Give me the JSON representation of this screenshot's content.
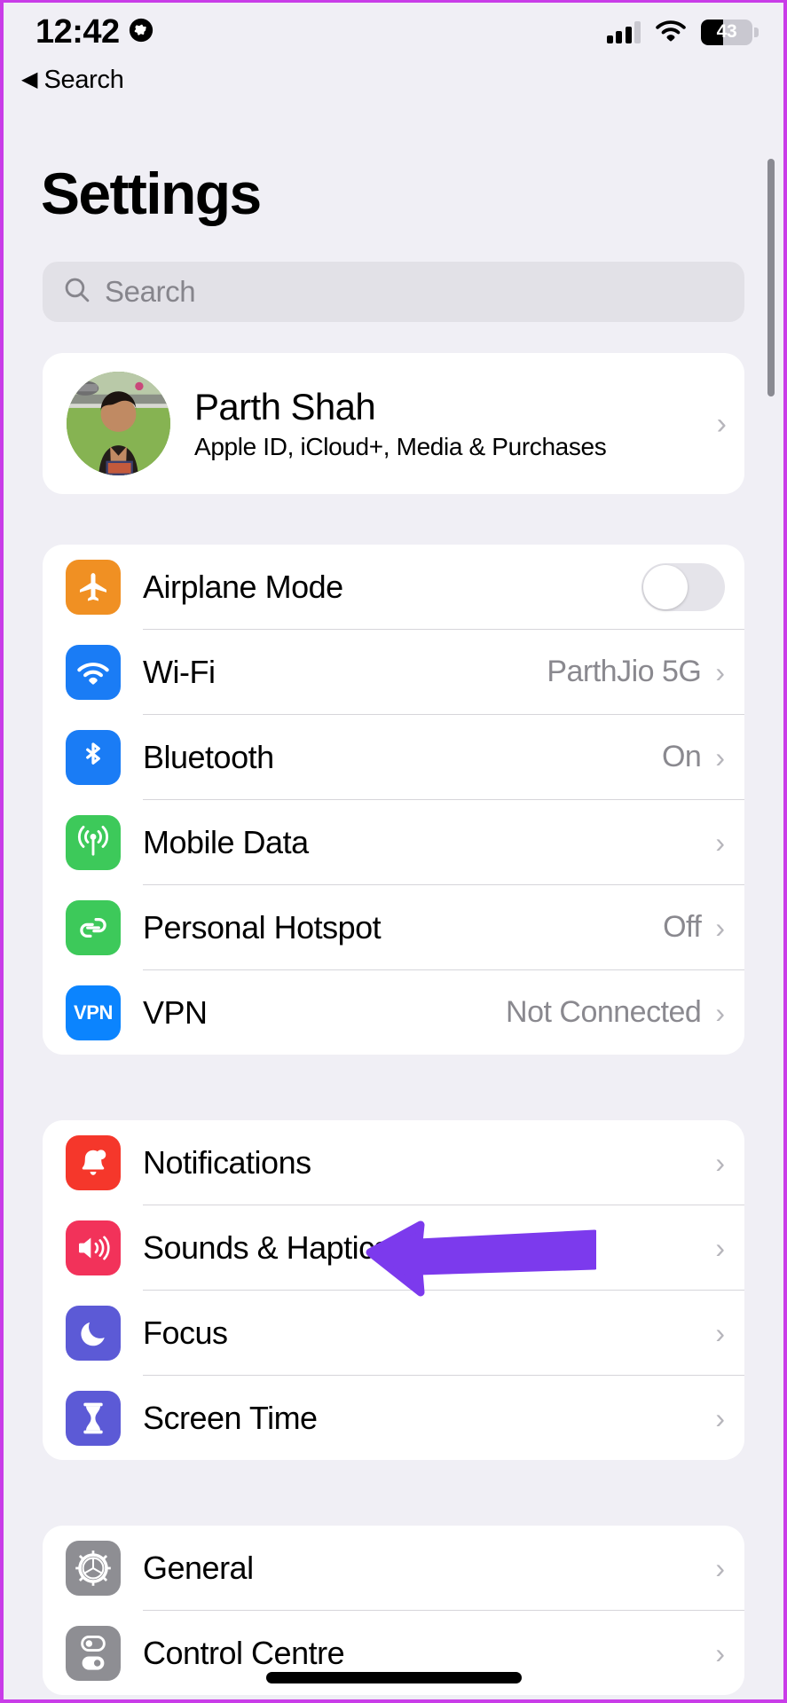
{
  "statusbar": {
    "time": "12:42",
    "location_icon": "globe-icon",
    "signal_icon": "cellular-bars-icon",
    "wifi_icon": "wifi-icon",
    "battery_percent": "43",
    "battery_level": 43
  },
  "nav": {
    "back_caret": "◀",
    "back_label": "Search"
  },
  "header": {
    "title": "Settings"
  },
  "search": {
    "icon": "search-icon",
    "placeholder": "Search",
    "value": ""
  },
  "profile": {
    "name": "Parth Shah",
    "subtitle": "Apple ID, iCloud+, Media & Purchases",
    "avatar_icon": "avatar",
    "chevron": "›"
  },
  "groups": [
    {
      "id": "connectivity",
      "rows": [
        {
          "label": "Airplane Mode",
          "icon": "airplane-icon",
          "icon_color": "#f09023",
          "control": "toggle",
          "toggle_on": false,
          "value": "",
          "chevron": ""
        },
        {
          "label": "Wi-Fi",
          "icon": "wifi-icon",
          "icon_color": "#1a7cf5",
          "control": "value",
          "value": "ParthJio 5G",
          "chevron": "›"
        },
        {
          "label": "Bluetooth",
          "icon": "bluetooth-icon",
          "icon_color": "#1a7cf5",
          "control": "value",
          "value": "On",
          "chevron": "›"
        },
        {
          "label": "Mobile Data",
          "icon": "antenna-icon",
          "icon_color": "#3dc95a",
          "control": "value",
          "value": "",
          "chevron": "›"
        },
        {
          "label": "Personal Hotspot",
          "icon": "hotspot-link-icon",
          "icon_color": "#3dc95a",
          "control": "value",
          "value": "Off",
          "chevron": "›"
        },
        {
          "label": "VPN",
          "icon": "vpn-icon",
          "icon_color": "#0b84fe",
          "icon_text": "VPN",
          "control": "value",
          "value": "Not Connected",
          "chevron": "›"
        }
      ]
    },
    {
      "id": "alerts",
      "rows": [
        {
          "label": "Notifications",
          "icon": "bell-icon",
          "icon_color": "#f5372b",
          "control": "value",
          "value": "",
          "chevron": "›"
        },
        {
          "label": "Sounds & Haptics",
          "icon": "speaker-icon",
          "icon_color": "#f2325a",
          "control": "value",
          "value": "",
          "chevron": "›"
        },
        {
          "label": "Focus",
          "icon": "moon-icon",
          "icon_color": "#5c5ad6",
          "control": "value",
          "value": "",
          "chevron": "›"
        },
        {
          "label": "Screen Time",
          "icon": "hourglass-icon",
          "icon_color": "#5c5ad6",
          "control": "value",
          "value": "",
          "chevron": "›"
        }
      ]
    },
    {
      "id": "system",
      "rows": [
        {
          "label": "General",
          "icon": "gear-icon",
          "icon_color": "#8e8e93",
          "control": "value",
          "value": "",
          "chevron": "›"
        },
        {
          "label": "Control Centre",
          "icon": "sliders-icon",
          "icon_color": "#8e8e93",
          "control": "value",
          "value": "",
          "chevron": "›"
        }
      ]
    }
  ],
  "annotation": {
    "arrow_color": "#7c3aed",
    "points_at": "Sounds & Haptics"
  },
  "colors": {
    "page_background": "#f0eff5",
    "card_background": "#ffffff",
    "frame_border": "#c93ce8",
    "secondary_text": "#8a898f",
    "chevron": "#b6b5bb"
  }
}
